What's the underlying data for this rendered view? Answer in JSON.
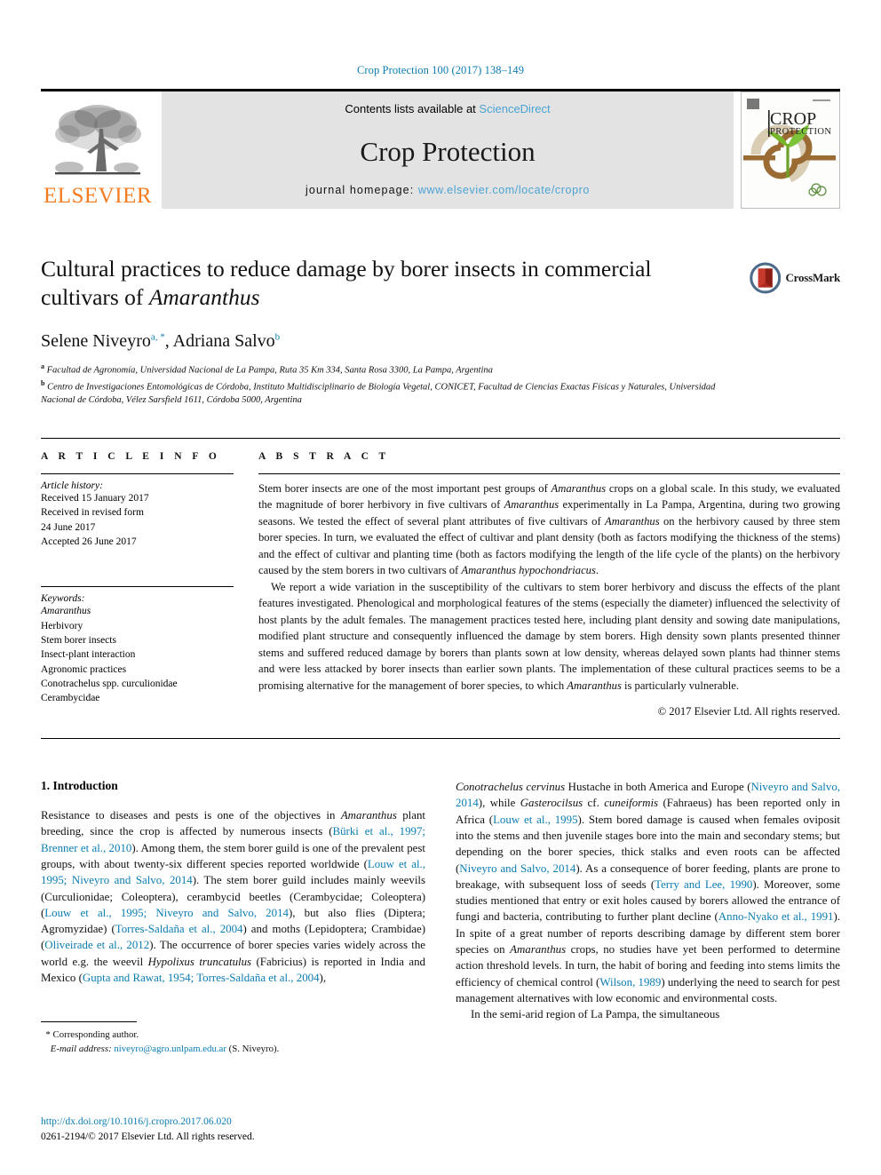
{
  "running_head": "Crop Protection 100 (2017) 138–149",
  "masthead": {
    "publisher_logo_text": "ELSEVIER",
    "contents_prefix": "Contents lists available at",
    "contents_link": "ScienceDirect",
    "journal_title": "Crop Protection",
    "homepage_prefix": "journal homepage:",
    "homepage_url": "www.elsevier.com/locate/cropro",
    "cover": {
      "title_line1": "CROP",
      "title_line2": "PROTECTION"
    }
  },
  "article": {
    "title_part1": "Cultural practices to reduce damage by borer insects in commercial cultivars of ",
    "title_italic": "Amaranthus",
    "crossmark_label": "CrossMark",
    "authors": [
      {
        "name": "Selene Niveyro",
        "marks": "a, *"
      },
      {
        "name": "Adriana Salvo",
        "marks": "b"
      }
    ],
    "affiliations": [
      {
        "mark": "a",
        "text": "Facultad de Agronomía, Universidad Nacional de La Pampa, Ruta 35 Km 334, Santa Rosa 3300, La Pampa, Argentina"
      },
      {
        "mark": "b",
        "text": "Centro de Investigaciones Entomológicas de Córdoba, Instituto Multidisciplinario de Biología Vegetal, CONICET, Facultad de Ciencias Exactas Físicas y Naturales, Universidad Nacional de Córdoba, Vélez Sarsfield 1611, Córdoba 5000, Argentina"
      }
    ]
  },
  "article_info": {
    "heading": "A R T I C L E   I N F O",
    "history_label": "Article history:",
    "history": [
      "Received 15 January 2017",
      "Received in revised form",
      "24 June 2017",
      "Accepted 26 June 2017"
    ],
    "keywords_label": "Keywords:",
    "keywords": [
      "Amaranthus",
      "Herbivory",
      "Stem borer insects",
      "Insect-plant interaction",
      "Agronomic practices",
      "Conotrachelus spp. curculionidae",
      "Cerambycidae"
    ],
    "keyword_italic_flags": [
      true,
      false,
      false,
      false,
      false,
      "partial",
      false
    ]
  },
  "abstract": {
    "heading": "A B S T R A C T",
    "paragraph1_a": "Stem borer insects are one of the most important pest groups of ",
    "paragraph1_i1": "Amaranthus",
    "paragraph1_b": " crops on a global scale. In this study, we evaluated the magnitude of borer herbivory in five cultivars of ",
    "paragraph1_i2": "Amaranthus",
    "paragraph1_c": " experimentally in La Pampa, Argentina, during two growing seasons. We tested the effect of several plant attributes of five cultivars of ",
    "paragraph1_i3": "Amaranthus",
    "paragraph1_d": " on the herbivory caused by three stem borer species. In turn, we evaluated the effect of cultivar and plant density (both as factors modifying the thickness of the stems) and the effect of cultivar and planting time (both as factors modifying the length of the life cycle of the plants) on the herbivory caused by the stem borers in two cultivars of ",
    "paragraph1_i4": "Amaranthus hypochondriacus",
    "paragraph1_e": ".",
    "paragraph2_a": "We report a wide variation in the susceptibility of the cultivars to stem borer herbivory and discuss the effects of the plant features investigated. Phenological and morphological features of the stems (especially the diameter) influenced the selectivity of host plants by the adult females. The management practices tested here, including plant density and sowing date manipulations, modified plant structure and consequently influenced the damage by stem borers. High density sown plants presented thinner stems and suffered reduced damage by borers than plants sown at low density, whereas delayed sown plants had thinner stems and were less attacked by borer insects than earlier sown plants. The implementation of these cultural practices seems to be a promising alternative for the management of borer species, to which ",
    "paragraph2_i1": "Amaranthus",
    "paragraph2_b": " is particularly vulnerable.",
    "copyright": "© 2017 Elsevier Ltd. All rights reserved."
  },
  "introduction": {
    "heading": "1. Introduction",
    "left_paragraph_parts": [
      {
        "t": "Resistance to diseases and pests is one of the objectives in ",
        "s": "plain"
      },
      {
        "t": "Amaranthus",
        "s": "italic"
      },
      {
        "t": " plant breeding, since the crop is affected by numerous insects (",
        "s": "plain"
      },
      {
        "t": "Bürki et al., 1997; Brenner et al., 2010",
        "s": "ref"
      },
      {
        "t": "). Among them, the stem borer guild is one of the prevalent pest groups, with about twenty-six different species reported worldwide (",
        "s": "plain"
      },
      {
        "t": "Louw et al., 1995; Niveyro and Salvo, 2014",
        "s": "ref"
      },
      {
        "t": "). The stem borer guild includes mainly weevils (Curculionidae; Coleoptera), cerambycid beetles (Cerambycidae; Coleoptera) (",
        "s": "plain"
      },
      {
        "t": "Louw et al., 1995; Niveyro and Salvo, 2014",
        "s": "ref"
      },
      {
        "t": "), but also flies (Diptera; Agromyzidae) (",
        "s": "plain"
      },
      {
        "t": "Torres-Saldaña et al., 2004",
        "s": "ref"
      },
      {
        "t": ") and moths (Lepidoptera; Crambidae) (",
        "s": "plain"
      },
      {
        "t": "Oliveirade et al., 2012",
        "s": "ref"
      },
      {
        "t": "). The occurrence of borer species varies widely across the world e.g. the weevil ",
        "s": "plain"
      },
      {
        "t": "Hypolixus truncatulus",
        "s": "italic"
      },
      {
        "t": " (Fabricius) is reported in India and Mexico (",
        "s": "plain"
      },
      {
        "t": "Gupta and Rawat, 1954; Torres-Saldaña et al., 2004",
        "s": "ref"
      },
      {
        "t": "),",
        "s": "plain"
      }
    ],
    "right_paragraph_parts": [
      {
        "t": "Conotrachelus cervinus",
        "s": "italic"
      },
      {
        "t": " Hustache in both America and Europe (",
        "s": "plain"
      },
      {
        "t": "Niveyro and Salvo, 2014",
        "s": "ref"
      },
      {
        "t": "), while ",
        "s": "plain"
      },
      {
        "t": "Gasterocilsus",
        "s": "italic"
      },
      {
        "t": " cf. ",
        "s": "plain"
      },
      {
        "t": "cuneiformis",
        "s": "italic"
      },
      {
        "t": " (Fahraeus) has been reported only in Africa (",
        "s": "plain"
      },
      {
        "t": "Louw et al., 1995",
        "s": "ref"
      },
      {
        "t": "). Stem bored damage is caused when females oviposit into the stems and then juvenile stages bore into the main and secondary stems; but depending on the borer species, thick stalks and even roots can be affected (",
        "s": "plain"
      },
      {
        "t": "Niveyro and Salvo, 2014",
        "s": "ref"
      },
      {
        "t": "). As a consequence of borer feeding, plants are prone to breakage, with subsequent loss of seeds (",
        "s": "plain"
      },
      {
        "t": "Terry and Lee, 1990",
        "s": "ref"
      },
      {
        "t": "). Moreover, some studies mentioned that entry or exit holes caused by borers allowed the entrance of fungi and bacteria, contributing to further plant decline (",
        "s": "plain"
      },
      {
        "t": "Anno-Nyako et al., 1991",
        "s": "ref"
      },
      {
        "t": "). In spite of a great number of reports describing damage by different stem borer species on ",
        "s": "plain"
      },
      {
        "t": "Amaranthus",
        "s": "italic"
      },
      {
        "t": " crops, no studies have yet been performed to determine action threshold levels. In turn, the habit of boring and feeding into stems limits the efficiency of chemical control (",
        "s": "plain"
      },
      {
        "t": "Wilson, 1989",
        "s": "ref"
      },
      {
        "t": ") underlying the need to search for pest management alternatives with low economic and environmental costs.",
        "s": "plain"
      }
    ],
    "right_paragraph2": "In the semi-arid region of La Pampa, the simultaneous"
  },
  "footnote": {
    "corresponding_marker": "*",
    "corresponding_label": "Corresponding author.",
    "email_label": "E-mail address:",
    "email": "niveyro@agro.unlpam.edu.ar",
    "email_suffix": "(S. Niveyro)."
  },
  "footer": {
    "doi": "http://dx.doi.org/10.1016/j.cropro.2017.06.020",
    "issn_line": "0261-2194/© 2017 Elsevier Ltd. All rights reserved."
  },
  "colors": {
    "link_blue": "#0b7cb0",
    "sciencedirect_blue": "#4ba3d3",
    "elsevier_orange": "#f47c20",
    "banner_grey": "#e3e3e3"
  }
}
